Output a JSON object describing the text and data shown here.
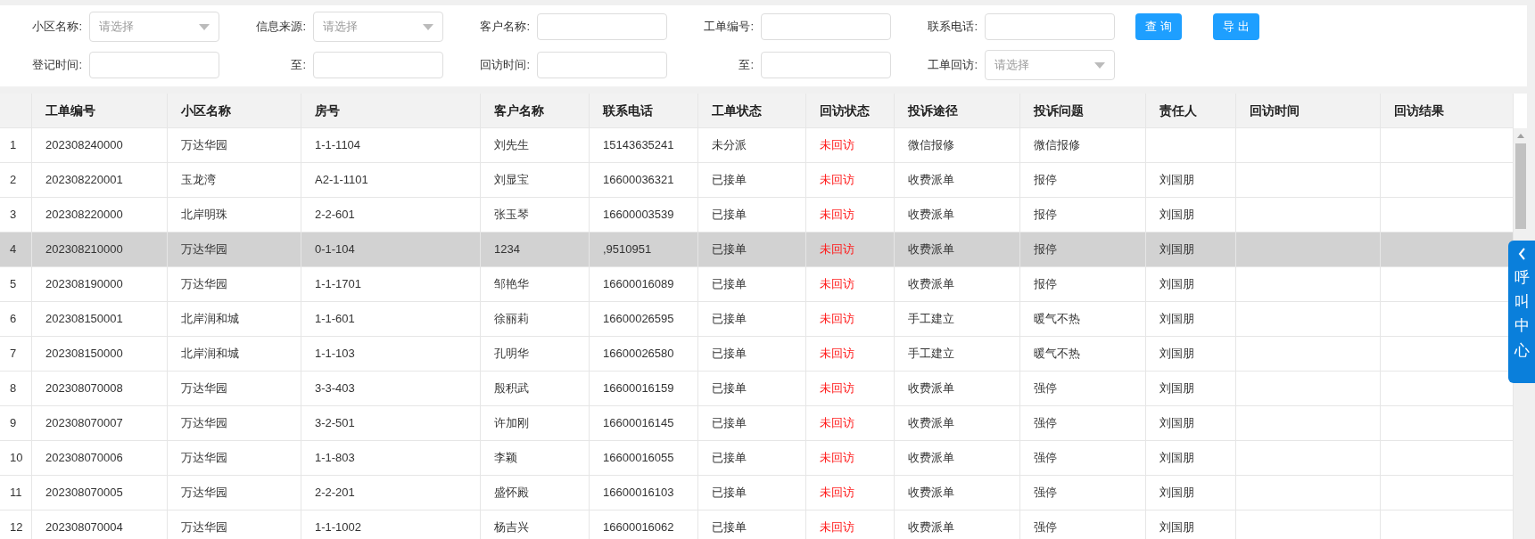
{
  "filters": [
    [
      {
        "label": "小区名称:",
        "kind": "select",
        "placeholder": "请选择"
      },
      {
        "label": "信息来源:",
        "kind": "select",
        "placeholder": "请选择"
      },
      {
        "label": "客户名称:",
        "kind": "input"
      },
      {
        "label": "工单编号:",
        "kind": "input"
      },
      {
        "label": "联系电话:",
        "kind": "input"
      }
    ],
    [
      {
        "label": "登记时间:",
        "kind": "input"
      },
      {
        "label": "至:",
        "kind": "input"
      },
      {
        "label": "回访时间:",
        "kind": "input"
      },
      {
        "label": "至:",
        "kind": "input"
      },
      {
        "label": "工单回访:",
        "kind": "select",
        "placeholder": "请选择"
      }
    ]
  ],
  "buttons": [
    "查 询",
    "导 出"
  ],
  "table": {
    "columns": [
      {
        "kind": "index"
      },
      {
        "label": "工单编号",
        "kind": "text"
      },
      {
        "label": "小区名称",
        "kind": "text"
      },
      {
        "label": "房号",
        "kind": "text"
      },
      {
        "label": "客户名称",
        "kind": "text"
      },
      {
        "label": "联系电话",
        "kind": "text"
      },
      {
        "label": "工单状态",
        "kind": "text"
      },
      {
        "label": "回访状态",
        "kind": "alert"
      },
      {
        "label": "投诉途径",
        "kind": "text"
      },
      {
        "label": "投诉问题",
        "kind": "text"
      },
      {
        "label": "责任人",
        "kind": "text"
      },
      {
        "label": "回访时间",
        "kind": "text"
      },
      {
        "label": "回访结果",
        "kind": "text"
      }
    ],
    "rows": [
      {
        "selected": false,
        "cells": [
          "1",
          "202308240000",
          "万达华园",
          "1-1-1104",
          "刘先生",
          "15143635241",
          "未分派",
          "未回访",
          "微信报修",
          "微信报修",
          "",
          "",
          ""
        ]
      },
      {
        "selected": false,
        "cells": [
          "2",
          "202308220001",
          "玉龙湾",
          "A2-1-1101",
          "刘显宝",
          "16600036321",
          "已接单",
          "未回访",
          "收费派单",
          "报停",
          "刘国朋",
          "",
          ""
        ]
      },
      {
        "selected": false,
        "cells": [
          "3",
          "202308220000",
          "北岸明珠",
          "2-2-601",
          "张玉琴",
          "16600003539",
          "已接单",
          "未回访",
          "收费派单",
          "报停",
          "刘国朋",
          "",
          ""
        ]
      },
      {
        "selected": true,
        "cells": [
          "4",
          "202308210000",
          "万达华园",
          "0-1-104",
          "1234",
          ",9510951",
          "已接单",
          "未回访",
          "收费派单",
          "报停",
          "刘国朋",
          "",
          ""
        ]
      },
      {
        "selected": false,
        "cells": [
          "5",
          "202308190000",
          "万达华园",
          "1-1-1701",
          "邹艳华",
          "16600016089",
          "已接单",
          "未回访",
          "收费派单",
          "报停",
          "刘国朋",
          "",
          ""
        ]
      },
      {
        "selected": false,
        "cells": [
          "6",
          "202308150001",
          "北岸润和城",
          "1-1-601",
          "徐丽莉",
          "16600026595",
          "已接单",
          "未回访",
          "手工建立",
          "暖气不热",
          "刘国朋",
          "",
          ""
        ]
      },
      {
        "selected": false,
        "cells": [
          "7",
          "202308150000",
          "北岸润和城",
          "1-1-103",
          "孔明华",
          "16600026580",
          "已接单",
          "未回访",
          "手工建立",
          "暖气不热",
          "刘国朋",
          "",
          ""
        ]
      },
      {
        "selected": false,
        "cells": [
          "8",
          "202308070008",
          "万达华园",
          "3-3-403",
          "殷积武",
          "16600016159",
          "已接单",
          "未回访",
          "收费派单",
          "强停",
          "刘国朋",
          "",
          ""
        ]
      },
      {
        "selected": false,
        "cells": [
          "9",
          "202308070007",
          "万达华园",
          "3-2-501",
          "许加刚",
          "16600016145",
          "已接单",
          "未回访",
          "收费派单",
          "强停",
          "刘国朋",
          "",
          ""
        ]
      },
      {
        "selected": false,
        "cells": [
          "10",
          "202308070006",
          "万达华园",
          "1-1-803",
          "李颖",
          "16600016055",
          "已接单",
          "未回访",
          "收费派单",
          "强停",
          "刘国朋",
          "",
          ""
        ]
      },
      {
        "selected": false,
        "cells": [
          "11",
          "202308070005",
          "万达华园",
          "2-2-201",
          "盛怀殿",
          "16600016103",
          "已接单",
          "未回访",
          "收费派单",
          "强停",
          "刘国朋",
          "",
          ""
        ]
      },
      {
        "selected": false,
        "cells": [
          "12",
          "202308070004",
          "万达华园",
          "1-1-1002",
          "杨吉兴",
          "16600016062",
          "已接单",
          "未回访",
          "收费派单",
          "强停",
          "刘国朋",
          "",
          ""
        ]
      }
    ]
  },
  "side_tab": {
    "label": "呼叫中心"
  }
}
